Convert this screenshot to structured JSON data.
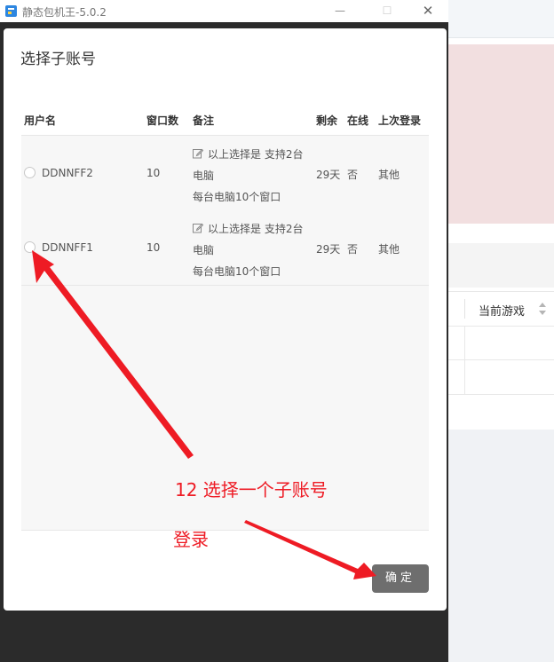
{
  "window": {
    "title": "静态包机王-5.0.2",
    "min_glyph": "—",
    "max_glyph": "☐",
    "close_glyph": "✕"
  },
  "background": {
    "column_header": "当前游戏"
  },
  "modal": {
    "title": "选择子账号",
    "columns": [
      "用户名",
      "窗口数",
      "备注",
      "剩余",
      "在线",
      "上次登录"
    ],
    "rows": [
      {
        "username": "DDNNFF2",
        "windows": "10",
        "note_line1": "以上选择是 支持2台",
        "note_line2": "电脑",
        "note_line3": "每台电脑10个窗口",
        "remaining": "29天",
        "online": "否",
        "last_login": "其他"
      },
      {
        "username": "DDNNFF1",
        "windows": "10",
        "note_line1": "以上选择是 支持2台",
        "note_line2": "电脑",
        "note_line3": "每台电脑10个窗口",
        "remaining": "29天",
        "online": "否",
        "last_login": "其他"
      }
    ],
    "confirm_label": "确定"
  },
  "annotations": {
    "step_text": "12 选择一个子账号",
    "login_text": "登录",
    "color": "#ee1b24"
  }
}
